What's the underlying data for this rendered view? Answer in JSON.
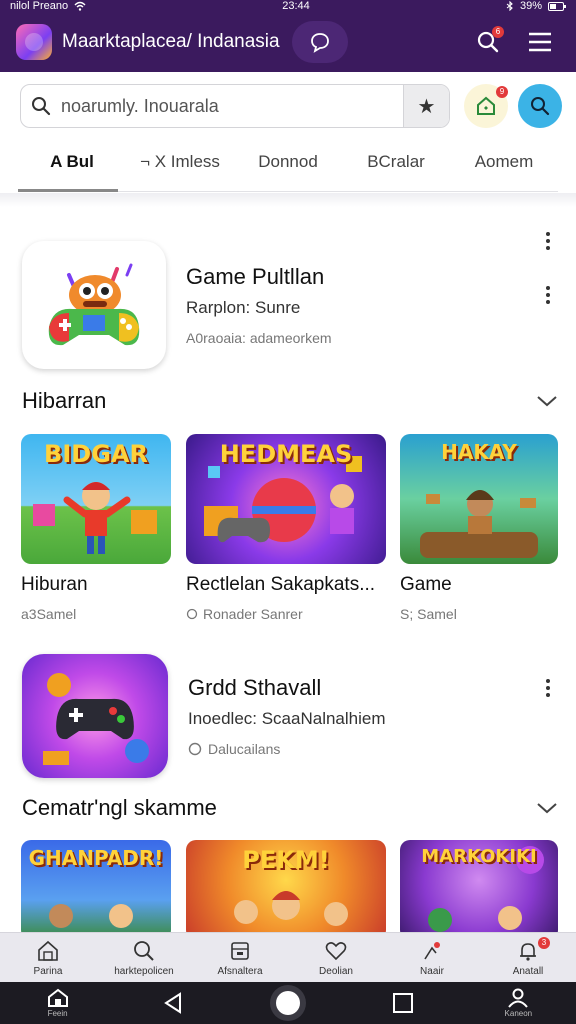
{
  "status_bar": {
    "carrier": "nilol Preano",
    "time": "23:44",
    "battery": "39%"
  },
  "app_bar": {
    "title": "Maarktaplacea/ Indanasia",
    "search_badge": "6"
  },
  "search": {
    "placeholder": "noarumly. Inouarala",
    "store_badge": "9"
  },
  "tabs": [
    {
      "label": "A Bul",
      "active": true
    },
    {
      "label": "¬ X Imless",
      "active": false
    },
    {
      "label": "Donnod",
      "active": false
    },
    {
      "label": "BCralar",
      "active": false
    },
    {
      "label": "Aomem",
      "active": false
    }
  ],
  "featured_app": {
    "title": "Game Pultllan",
    "subtitle": "Rarplon: Sunre",
    "meta": "A0raoaia: adameorkem"
  },
  "section_1": {
    "title": "Hibarran"
  },
  "cards_1": [
    {
      "art_text": "BIDGAR",
      "title": "Hiburan",
      "sub": "a3Samel"
    },
    {
      "art_text": "HEDMEAS",
      "title": "Rectlelan Sakapkats...",
      "sub": "Ronader Sanrer"
    },
    {
      "art_text": "HAKAY",
      "title": "Game",
      "sub": "S; Samel"
    }
  ],
  "second_app": {
    "title": "Grdd Sthavall",
    "subtitle": "Inoedlec: ScaaNalnalhiem",
    "meta": "Dalucailans"
  },
  "section_2": {
    "title": "Cematr'ngl skamme"
  },
  "cards_2": [
    {
      "art_text": "GHANPADR!"
    },
    {
      "art_text": "PEKM!"
    },
    {
      "art_text": "MARKOKIKI"
    }
  ],
  "bottom_nav": [
    {
      "label": "Parina",
      "icon": "home-outline-icon"
    },
    {
      "label": "harktepolicen",
      "icon": "search-icon"
    },
    {
      "label": "Afsnaltera",
      "icon": "box-icon"
    },
    {
      "label": "Deolian",
      "icon": "heart-icon"
    },
    {
      "label": "Naair",
      "icon": "tag-icon",
      "badge": ""
    },
    {
      "label": "Anatall",
      "icon": "bell-icon",
      "badge": "3"
    }
  ],
  "system_nav": {
    "home_label": "Feein",
    "account_label": "Kaneon"
  },
  "colors": {
    "header": "#3b1a5e",
    "accent": "#3bb3e6",
    "badge": "#e23a3a"
  }
}
